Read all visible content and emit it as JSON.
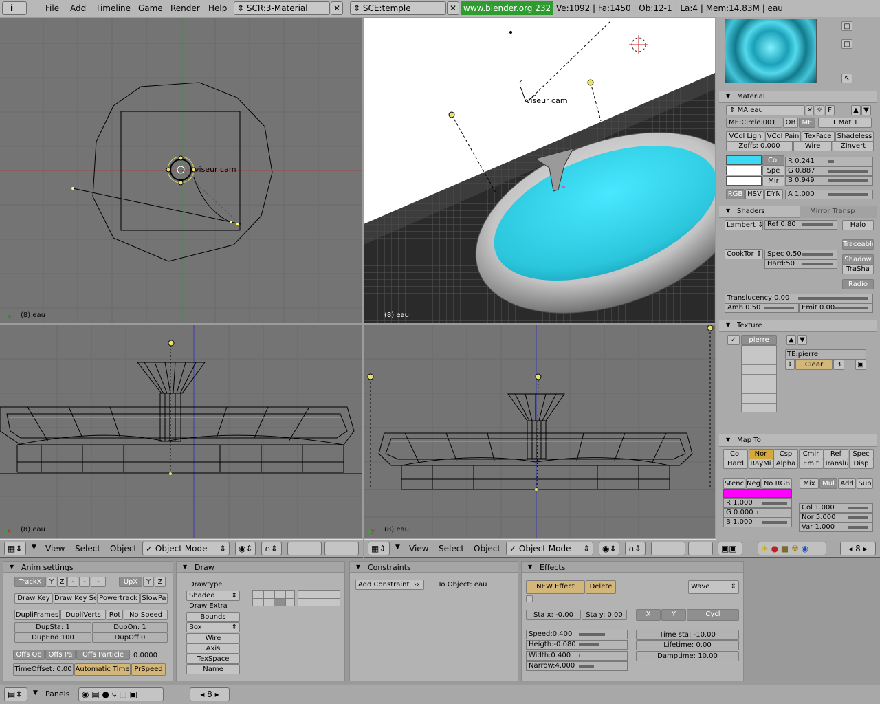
{
  "topbar": {
    "menu": [
      "File",
      "Add",
      "Timeline",
      "Game",
      "Render",
      "Help"
    ],
    "screen": "SCR:3-Material",
    "scene": "SCE:temple",
    "url": "www.blender.org 232",
    "stats": "Ve:1092 | Fa:1450 | Ob:12-1 | La:4 | Mem:14.83M | eau"
  },
  "viewports": {
    "top_left_label": "(8) eau",
    "top_right_label": "(8) eau",
    "bottom_left_label": "(8) eau",
    "bottom_right_label": "(8) eau",
    "camera_label_left": "viseur cam",
    "camera_label_right": "viseur cam"
  },
  "view_header": {
    "left": {
      "view": "View",
      "select": "Select",
      "object": "Object",
      "mode": "Object Mode"
    },
    "right": {
      "view": "View",
      "select": "Select",
      "object": "Object",
      "mode": "Object Mode"
    },
    "frame": "8"
  },
  "material": {
    "title": "Material",
    "ma_name": "MA:eau",
    "f_btn": "F",
    "me_name": "ME:Circle.001",
    "ob": "OB",
    "me": "ME",
    "mat_count": "1 Mat 1",
    "vcol_light": "VCol Ligh",
    "vcol_paint": "VCol Pain",
    "texface": "TexFace",
    "shadeless": "Shadeless",
    "zoffs": "Zoffs: 0.000",
    "wire": "Wire",
    "zinvert": "ZInvert",
    "col": "Col",
    "spe": "Spe",
    "mir": "Mir",
    "r": "R 0.241",
    "g": "G 0.887",
    "b": "B 0.949",
    "a": "A 1.000",
    "rgb": "RGB",
    "hsv": "HSV",
    "dyn": "DYN",
    "swatch_color": "#3dd9f2"
  },
  "shaders": {
    "tab1": "Shaders",
    "tab2": "Mirror Transp",
    "diffuse": "Lambert",
    "ref": "Ref  0.80",
    "halo": "Halo",
    "traceable": "Traceable",
    "specular": "CookTor",
    "spec": "Spec 0.50",
    "hard": "Hard:50",
    "shadow": "Shadow",
    "trasha": "TraSha",
    "radio": "Radio",
    "translucency": "Translucency 0.00",
    "amb": "Amb 0.50",
    "emit": "Emit 0.00"
  },
  "texture": {
    "title": "Texture",
    "slot": "pierre",
    "te_name": "TE:pierre",
    "clear": "Clear",
    "users": "3"
  },
  "mapto": {
    "title": "Map To",
    "row1": [
      "Col",
      "Nor",
      "Csp",
      "Cmir",
      "Ref",
      "Spec"
    ],
    "row2": [
      "Hard",
      "RayMi",
      "Alpha",
      "Emit",
      "Translu",
      "Disp"
    ],
    "stencil": "Stenc",
    "neg": "Neg",
    "norgb": "No RGB",
    "blend": [
      "Mix",
      "Mul",
      "Add",
      "Sub"
    ],
    "r": "R 1.000",
    "g": "G 0.000",
    "b": "B 1.000",
    "col": "Col 1.000",
    "nor": "Nor 5.000",
    "var": "Var 1.000",
    "swatch_color": "#ff00ff"
  },
  "buttons_header": {
    "frame": "8"
  },
  "anim_settings": {
    "title": "Anim settings",
    "trackx": "TrackX",
    "y": "Y",
    "z": "Z",
    "mx": "-",
    "my": "-",
    "mz": "-",
    "upx": "UpX",
    "upy": "Y",
    "upz": "Z",
    "draw_key": "Draw Key",
    "draw_key_sel": "Draw Key Se",
    "powertrack": "Powertrack",
    "slowpar": "SlowPa",
    "dupliframes": "DupliFrames",
    "dupliverts": "DupliVerts",
    "rot": "Rot",
    "nospeed": "No Speed",
    "dupsta": "DupSta: 1",
    "dupon": "DupOn: 1",
    "dupend": "DupEnd 100",
    "dupoff": "DupOff 0",
    "offs_ob": "Offs Ob",
    "offs_par": "Offs Pa",
    "offs_particle": "Offs Particle",
    "value": "0.0000",
    "timeoffset": "TimeOffset: 0.00",
    "automatic_time": "Automatic Time",
    "prspeed": "PrSpeed"
  },
  "draw": {
    "title": "Draw",
    "drawtype_label": "Drawtype",
    "drawtype": "Shaded",
    "draw_extra": "Draw Extra",
    "bounds": "Bounds",
    "box": "Box",
    "wire": "Wire",
    "axis": "Axis",
    "texspace": "TexSpace",
    "name": "Name"
  },
  "constraints": {
    "title": "Constraints",
    "add": "Add Constraint",
    "to_object": "To Object: eau"
  },
  "effects": {
    "title": "Effects",
    "new": "NEW Effect",
    "delete": "Delete",
    "type": "Wave",
    "stax": "Sta x: -0.00",
    "stay": "Sta y: 0.00",
    "x": "X",
    "y": "Y",
    "cycl": "Cycl",
    "speed": "Speed:0.400",
    "height": "Heigth:-0.080",
    "width": "Width:0.400",
    "narrow": "Narrow:4.000",
    "timesta": "Time sta: -10.00",
    "lifetime": "Lifetime: 0.00",
    "damptime": "Damptime: 10.00"
  },
  "statusbar": {
    "panels": "Panels",
    "frame": "8"
  }
}
